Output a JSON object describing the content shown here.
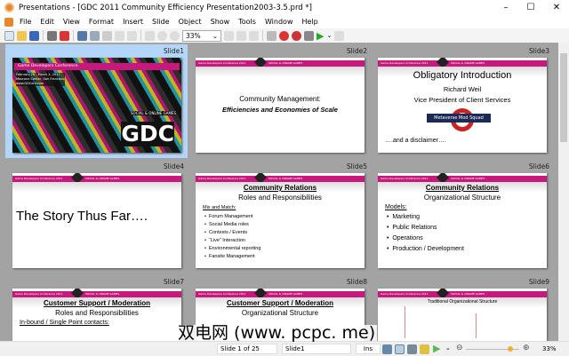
{
  "window": {
    "title": "Presentations - [GDC 2011 Community Efficiency Presentation2003-3.5.prd *]"
  },
  "menu": [
    "File",
    "Edit",
    "View",
    "Format",
    "Insert",
    "Slide",
    "Object",
    "Show",
    "Tools",
    "Window",
    "Help"
  ],
  "toolbar": {
    "zoom": "33%"
  },
  "slides": [
    {
      "label": "Slide1",
      "type": "title-art",
      "selected": true,
      "lines": [
        "Game Developers Conference",
        "February 28 - March 4, 2011",
        "Moscone Center, San Francisco",
        "www.GDConf.com",
        "SOCIAL & ONLINE GAMES",
        "GDC"
      ]
    },
    {
      "label": "Slide2",
      "type": "center",
      "lines": [
        "Community Management:",
        "Efficiencies and Economies of Scale"
      ]
    },
    {
      "label": "Slide3",
      "type": "intro",
      "lines": [
        "Obligatory Introduction",
        "Richard Weil",
        "Vice President of Client Services",
        "Metaverse Mod Squad",
        "….and a disclaimer…."
      ]
    },
    {
      "label": "Slide4",
      "type": "big",
      "lines": [
        "The Story Thus Far…."
      ]
    },
    {
      "label": "Slide5",
      "type": "list-small",
      "title": "Community Relations",
      "subtitle": "Roles and Responsibilities",
      "heading": "Mix and Match:",
      "bullets": [
        "Forum Management",
        "Social Media roles",
        "Contests / Events",
        "“Live” Interaction",
        "Environmental reporting",
        "Fansite Management"
      ]
    },
    {
      "label": "Slide6",
      "type": "list",
      "title": "Community Relations",
      "subtitle": "Organizational Structure",
      "heading": "Models:",
      "bullets": [
        "Marketing",
        "Public Relations",
        "Operations",
        "Production / Development"
      ]
    },
    {
      "label": "Slide7",
      "type": "list",
      "title": "Customer Support / Moderation",
      "subtitle": "Roles and Responsibilities",
      "heading": "In-bound / Single Point contacts:",
      "bullets": []
    },
    {
      "label": "Slide8",
      "type": "list",
      "title": "Customer Support / Moderation",
      "subtitle": "Organizational Structure",
      "heading": "",
      "bullets": []
    },
    {
      "label": "Slide9",
      "type": "chart",
      "lines": [
        "Traditional Organizational Structure"
      ]
    }
  ],
  "header_band": {
    "left": "Game Developers Conference 2011",
    "center": "SOCIAL & ONLINE GAMES"
  },
  "status": {
    "position": "Slide 1 of 25",
    "slide_name": "Slide1",
    "mode": "Ins",
    "zoom": "33%",
    "zoom_fraction": 0.33
  },
  "watermark": "双电网 (www. pcpc. me)"
}
